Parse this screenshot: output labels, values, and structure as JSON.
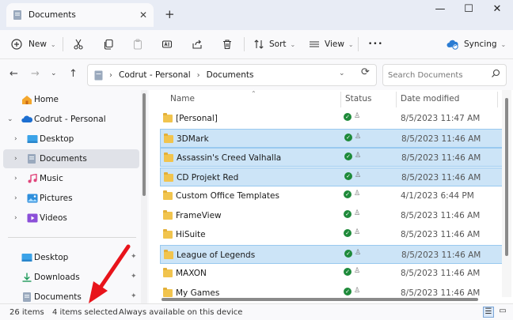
{
  "window": {
    "tab_title": "Documents",
    "tab_close": "✕",
    "new_tab": "+",
    "minimize": "—",
    "maximize": "☐",
    "close": "✕"
  },
  "toolbar": {
    "new_label": "New",
    "sort_label": "Sort",
    "view_label": "View",
    "more_label": "•••",
    "sync_label": "Syncing"
  },
  "address": {
    "segments": [
      "Codrut - Personal",
      "Documents"
    ],
    "search_placeholder": "Search Documents"
  },
  "sidebar": {
    "items": [
      {
        "label": "Home",
        "icon": "home-icon"
      },
      {
        "label": "Codrut - Personal",
        "icon": "onedrive-cloud-icon",
        "expanded": true
      },
      {
        "label": "Desktop",
        "icon": "desktop-folder-icon"
      },
      {
        "label": "Documents",
        "icon": "documents-folder-icon",
        "selected": true
      },
      {
        "label": "Music",
        "icon": "music-icon"
      },
      {
        "label": "Pictures",
        "icon": "pictures-icon"
      },
      {
        "label": "Videos",
        "icon": "videos-icon"
      }
    ],
    "pinned": [
      {
        "label": "Desktop",
        "icon": "desktop-folder-icon"
      },
      {
        "label": "Downloads",
        "icon": "downloads-icon"
      },
      {
        "label": "Documents",
        "icon": "documents-folder-icon"
      }
    ]
  },
  "columns": {
    "name": "Name",
    "status": "Status",
    "date": "Date modified"
  },
  "files": [
    {
      "name": "[Personal]",
      "date": "8/5/2023 11:47 AM",
      "selected": false
    },
    {
      "name": "3DMark",
      "date": "8/5/2023 11:46 AM",
      "selected": true
    },
    {
      "name": "Assassin's Creed Valhalla",
      "date": "8/5/2023 11:46 AM",
      "selected": true
    },
    {
      "name": "CD Projekt Red",
      "date": "8/5/2023 11:46 AM",
      "selected": true
    },
    {
      "name": "Custom Office Templates",
      "date": "4/1/2023 6:44 PM",
      "selected": false
    },
    {
      "name": "FrameView",
      "date": "8/5/2023 11:46 AM",
      "selected": false
    },
    {
      "name": "HiSuite",
      "date": "8/5/2023 11:46 AM",
      "selected": false
    },
    {
      "name": "League of Legends",
      "date": "8/5/2023 11:46 AM",
      "selected": true
    },
    {
      "name": "MAXON",
      "date": "8/5/2023 11:46 AM",
      "selected": false
    },
    {
      "name": "My Games",
      "date": "8/5/2023 11:46 AM",
      "selected": false
    }
  ],
  "statusbar": {
    "item_count": "26 items",
    "selected_count": "4 items selected",
    "availability": "Always available on this device"
  },
  "colors": {
    "selection_bg": "#cce4f7",
    "selection_border": "#99c9ef",
    "folder": "#f1c44e",
    "synced_green": "#1e8a3a",
    "annotation_red": "#e8141b"
  }
}
